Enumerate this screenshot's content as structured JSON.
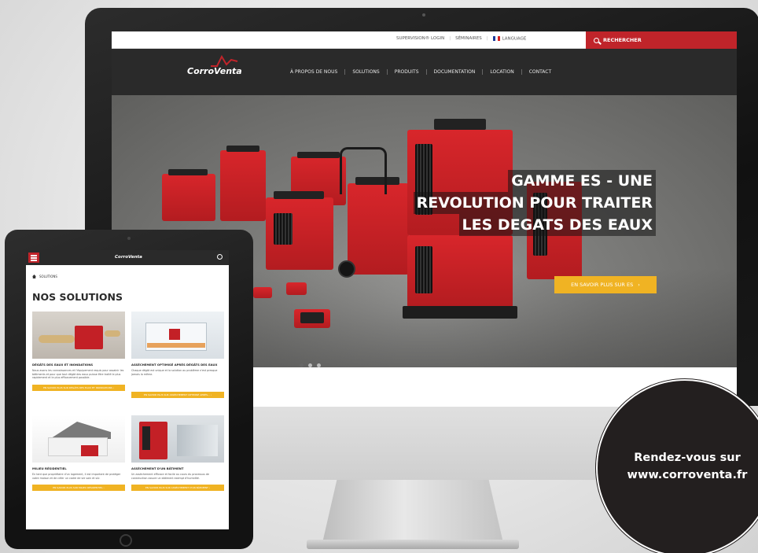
{
  "desktop_site": {
    "util_bar": {
      "supervision_login": "SUPERVISION® LOGIN",
      "seminaires": "SÉMINAIRES",
      "language": "LANGUAGE",
      "search": "RECHERCHER"
    },
    "brand": "CorroVenta",
    "nav": [
      "À PROPOS DE NOUS",
      "SOLUTIONS",
      "PRODUITS",
      "DOCUMENTATION",
      "LOCATION",
      "CONTACT"
    ],
    "hero": {
      "title_lines": [
        "GAMME ES - UNE",
        "REVOLUTION POUR TRAITER",
        "LES DEGATS DES EAUX"
      ],
      "cta": "EN SAVOIR PLUS SUR ES",
      "cta_arrow": "›"
    },
    "slider": {
      "count": 3,
      "active": 1
    }
  },
  "mobile_site": {
    "brand": "CorroVenta",
    "breadcrumb": "SOLUTIONS",
    "heading": "NOS SOLUTIONS",
    "cards": [
      {
        "title": "DÉGÂTS DES EAUX ET INONDATIONS",
        "text": "Nous avons les connaissances et l'équipement requis pour assainir les bâtiments et pour que tout dégât des eaux puisse être traité le plus rapidement et le plus efficacement possible.",
        "cta": "EN SAVOIR PLUS SUR DÉGÂTS DES EAUX ET INONDATIONS ›"
      },
      {
        "title": "ASSÈCHEMENT OPTIMISÉ APRÈS DÉGÂTS DES EAUX",
        "text": "Chaque dégât est unique et la solution au problème n'est presque jamais la même.",
        "cta": "EN SAVOIR PLUS SUR ASSÈCHEMENT OPTIMISÉ APRÈS… ›"
      },
      {
        "title": "MILIEU RÉSIDENTIEL",
        "text": "En tant que propriétaire d'un logement, il est important de protéger votre maison et de créer un cadre de vie sain et sûr.",
        "cta": "EN SAVOIR PLUS SUR MILIEU RÉSIDENTIEL ›"
      },
      {
        "title": "ASSÈCHEMENT D'UN BÂTIMENT",
        "text": "Un assèchement efficace et facile au cours du processus de construction assure un bâtiment exempt d'humidité.",
        "cta": "EN SAVOIR PLUS SUR ASSÈCHEMENT D'UN BÂTIMENT ›"
      }
    ]
  },
  "badge": {
    "line1": "Rendez-vous sur",
    "line2": "www.corroventa.fr"
  },
  "colors": {
    "brand_red": "#c0242a",
    "cta_yellow": "#f0b323",
    "nav_dark": "#2a2a2a",
    "badge_bg": "#231f1f"
  }
}
